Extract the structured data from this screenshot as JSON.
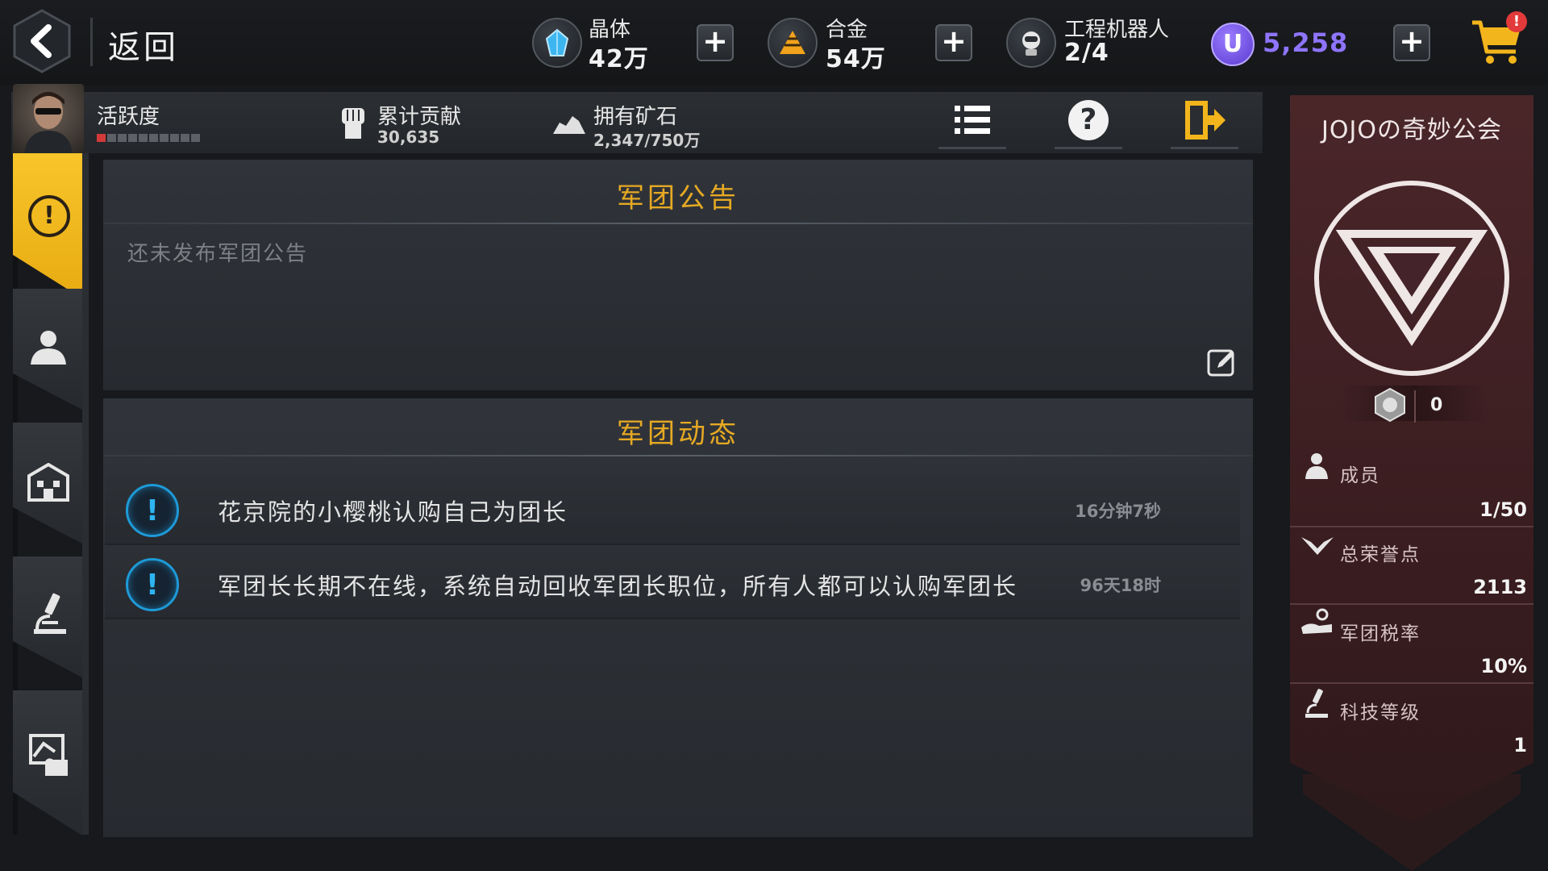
{
  "topbar": {
    "back_label": "返回",
    "resources": [
      {
        "name": "晶体",
        "value": "42万",
        "icon": "crystal-icon",
        "color": "#3db6f0"
      },
      {
        "name": "合金",
        "value": "54万",
        "icon": "alloy-icon",
        "color": "#f2a21b"
      },
      {
        "name": "工程机器人",
        "value": "2/4",
        "icon": "robot-icon"
      }
    ],
    "currency": {
      "value": "5,258",
      "icon": "u-coin-icon",
      "color": "#7b5cf0"
    },
    "shop": {
      "icon": "shopping-cart-icon",
      "badge": "!"
    }
  },
  "subbar": {
    "activity_label": "活跃度",
    "activity_level": 0.1,
    "contribution_label": "累计贡献",
    "contribution_value": "30,635",
    "ore_label": "拥有矿石",
    "ore_value": "2,347/750万"
  },
  "nav": [
    {
      "id": "announcement",
      "icon": "alert-icon",
      "active": true
    },
    {
      "id": "members",
      "icon": "member-icon",
      "active": false
    },
    {
      "id": "buildings",
      "icon": "building-icon",
      "active": false
    },
    {
      "id": "tech",
      "icon": "microscope-icon",
      "active": false
    },
    {
      "id": "donate",
      "icon": "donate-icon",
      "active": false
    }
  ],
  "announcement": {
    "title": "军团公告",
    "body": "还未发布军团公告"
  },
  "feed": {
    "title": "军团动态",
    "items": [
      {
        "text": "花京院的小樱桃认购自己为团长",
        "time": "16分钟7秒"
      },
      {
        "text": "军团长长期不在线，系统自动回收军团长职位，所有人都可以认购军团长",
        "time": "96天18时"
      }
    ]
  },
  "guild": {
    "name": "JOJOの奇妙公会",
    "level": "0",
    "stats": [
      {
        "label": "成员",
        "value": "1/50",
        "icon": "member-icon"
      },
      {
        "label": "总荣誉点",
        "value": "2113",
        "icon": "wings-icon"
      },
      {
        "label": "军团税率",
        "value": "10%",
        "icon": "tax-icon"
      },
      {
        "label": "科技等级",
        "value": "1",
        "icon": "microscope-icon"
      }
    ]
  },
  "colors": {
    "accent_gold": "#e6a923",
    "feed_blue": "#1e9ad8",
    "guild_red": "#4a2629"
  }
}
